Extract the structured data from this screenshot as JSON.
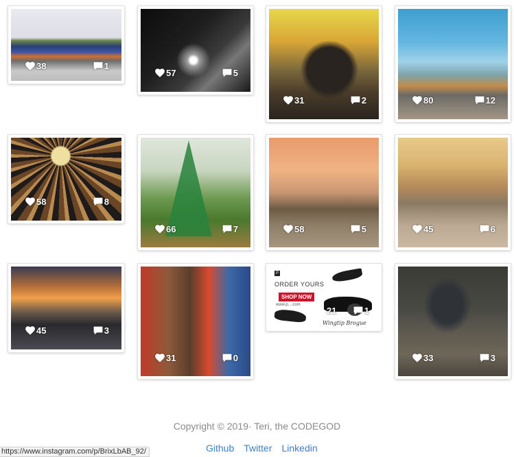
{
  "posts": [
    {
      "likes": "38",
      "comments": "1"
    },
    {
      "likes": "57",
      "comments": "5"
    },
    {
      "likes": "31",
      "comments": "2"
    },
    {
      "likes": "80",
      "comments": "12"
    },
    {
      "likes": "58",
      "comments": "8"
    },
    {
      "likes": "66",
      "comments": "7"
    },
    {
      "likes": "58",
      "comments": "5"
    },
    {
      "likes": "45",
      "comments": "6"
    },
    {
      "likes": "45",
      "comments": "3"
    },
    {
      "likes": "31",
      "comments": "0"
    },
    {
      "likes": "21",
      "comments": "1"
    },
    {
      "likes": "33",
      "comments": "3"
    }
  ],
  "ad": {
    "brand": "P",
    "headline": "ORDER YOURS",
    "button": "SHOP NOW",
    "url": "www.p....com",
    "product": "Wingtip Brogue"
  },
  "footer": {
    "copyright": "Copyright © 2019· Teri, the CODEGOD",
    "links": [
      "Github",
      "Twitter",
      "Linkedin"
    ]
  },
  "status_bar": {
    "url": "https://www.instagram.com/p/BrixLbAB_92/"
  },
  "colors": {
    "link": "#3f7fc4",
    "footer_text": "#8a8a8a",
    "ad_button": "#d0112b"
  }
}
